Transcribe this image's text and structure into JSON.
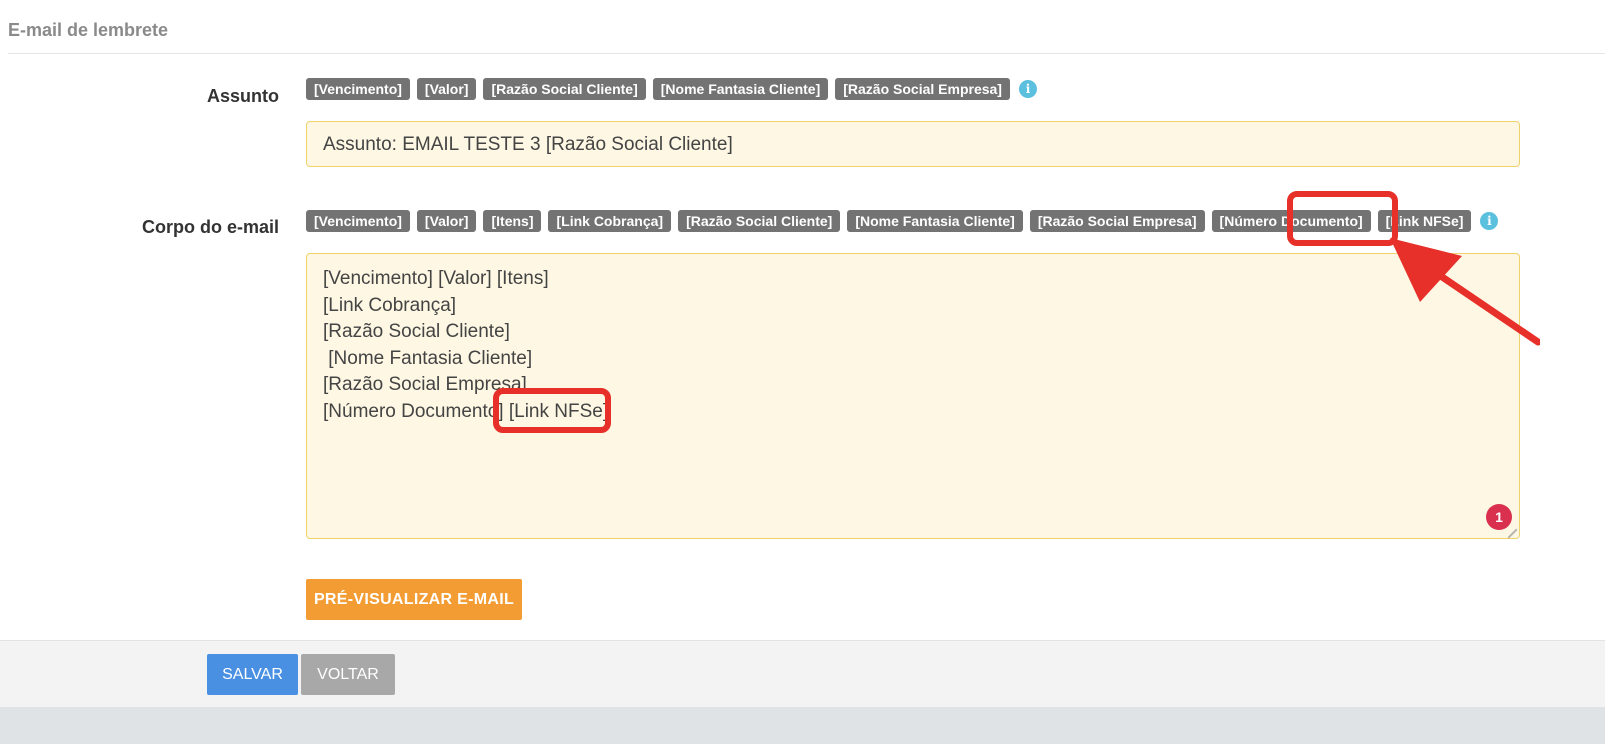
{
  "section": {
    "title": "E-mail de lembrete"
  },
  "subject": {
    "label": "Assunto",
    "tags": [
      "[Vencimento]",
      "[Valor]",
      "[Razão Social Cliente]",
      "[Nome Fantasia Cliente]",
      "[Razão Social Empresa]"
    ],
    "value": "Assunto: EMAIL TESTE 3 [Razão Social Cliente]"
  },
  "body": {
    "label": "Corpo do e-mail",
    "tags": [
      "[Vencimento]",
      "[Valor]",
      "[Itens]",
      "[Link Cobrança]",
      "[Razão Social Cliente]",
      "[Nome Fantasia Cliente]",
      "[Razão Social Empresa]",
      "[Número Documento]",
      "[Link NFSe]"
    ],
    "lines": [
      "[Vencimento] [Valor] [Itens]",
      "[Link Cobrança]",
      "[Razão Social Cliente]",
      " [Nome Fantasia Cliente]",
      "[Razão Social Empresa]",
      "[Número Documento] [Link NFSe]"
    ],
    "badge_count": "1"
  },
  "info_icon": "i",
  "buttons": {
    "preview": "PRÉ-VISUALIZAR E-MAIL",
    "save": "SALVAR",
    "back": "VOLTAR"
  },
  "colors": {
    "tag": "#737373",
    "info": "#5bc0de",
    "input_bg": "#fdf7e3",
    "input_border": "#f0d26a",
    "preview": "#f39c33",
    "save": "#4a90e2",
    "back": "#a8a8a8",
    "annotation": "#e8302a"
  },
  "icons": {
    "info": "info-icon",
    "resize": "resize-handle-icon",
    "arrow": "annotation-arrow-icon"
  }
}
